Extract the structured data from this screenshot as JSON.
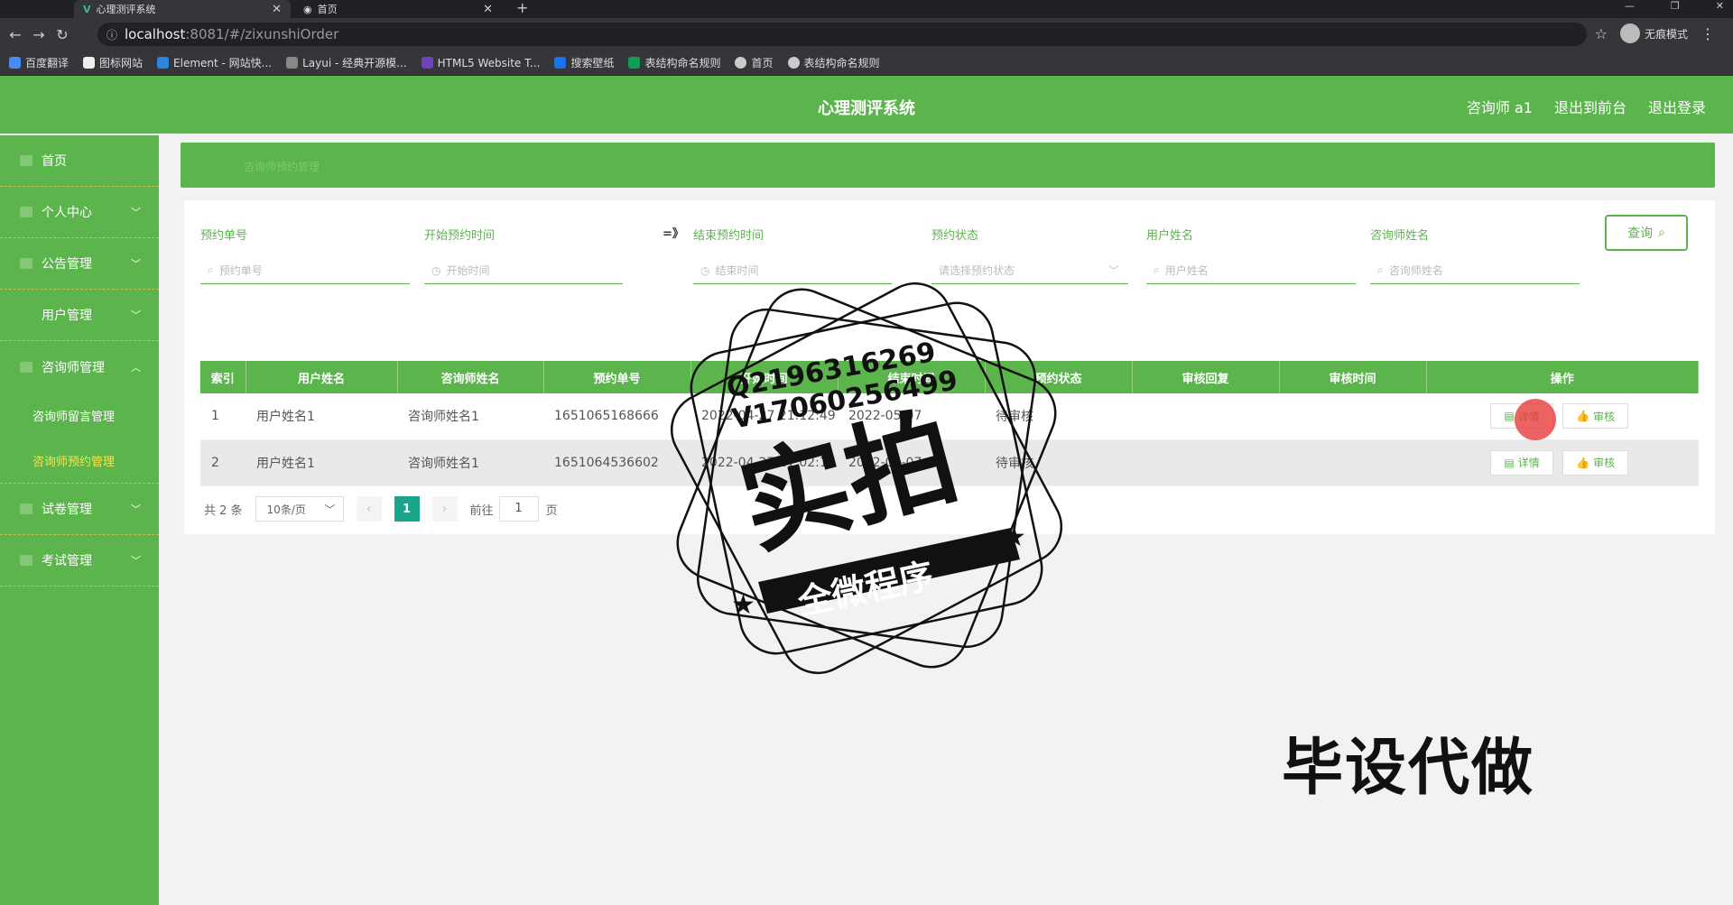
{
  "browser": {
    "tabs": [
      {
        "title": "心理测评系统",
        "close": "✕"
      },
      {
        "title": "首页",
        "close": "✕"
      }
    ],
    "new_tab": "+",
    "url_host": "localhost",
    "url_path": ":8081/#/zixunshiOrder",
    "incognito_label": "无痕模式",
    "bookmarks": [
      "百度翻译",
      "图标网站",
      "Element - 网站快...",
      "Layui - 经典开源模...",
      "HTML5 Website T...",
      "搜索壁纸",
      "表结构命名规则",
      "首页",
      "表结构命名规则"
    ]
  },
  "header": {
    "title": "心理测评系统",
    "links": [
      "咨询师 a1",
      "退出到前台",
      "退出登录"
    ]
  },
  "sidebar": {
    "items": [
      {
        "label": "首页",
        "chevron": ""
      },
      {
        "label": "个人中心",
        "chevron": "﹀"
      },
      {
        "label": "公告管理",
        "chevron": "﹀"
      },
      {
        "label": "用户管理",
        "chevron": "﹀"
      },
      {
        "label": "咨询师管理",
        "chevron": "︿"
      }
    ],
    "sub_items": [
      "咨询师留言管理",
      "咨询师预约管理"
    ],
    "items_after": [
      {
        "label": "试卷管理",
        "chevron": "﹀"
      },
      {
        "label": "考试管理",
        "chevron": "﹀"
      }
    ]
  },
  "breadcrumb": "咨询师预约管理",
  "filters": [
    {
      "label": "预约单号",
      "placeholder": "预约单号"
    },
    {
      "label": "开始预约时间",
      "placeholder": "开始时间"
    },
    {
      "label": "结束预约时间",
      "placeholder": "结束时间"
    },
    {
      "label": "预约状态",
      "placeholder": "请选择预约状态"
    },
    {
      "label": "用户姓名",
      "placeholder": "用户姓名"
    },
    {
      "label": "咨询师姓名",
      "placeholder": "咨询师姓名"
    }
  ],
  "range_arrow": "=》",
  "query_label": "查询",
  "table": {
    "headers": [
      "索引",
      "用户姓名",
      "咨询师姓名",
      "预约单号",
      "开始时间",
      "结束时间",
      "预约状态",
      "审核回复",
      "审核时间",
      "操作"
    ],
    "rows": [
      [
        "1",
        "用户姓名1",
        "咨询师姓名1",
        "1651065168666",
        "2022-04-27 21:12:49",
        "2022-05-07",
        "待审核",
        "",
        ""
      ],
      [
        "2",
        "用户姓名1",
        "咨询师姓名1",
        "1651064536602",
        "2022-04-27 21:02:17",
        "2022-05-07",
        "待审核",
        "",
        ""
      ]
    ],
    "detail_label": "详情",
    "audit_label": "审核"
  },
  "pager": {
    "total": "共 2 条",
    "page_size": "10条/页",
    "current": "1",
    "goto_prefix": "前往",
    "goto_value": "1",
    "goto_suffix": "页"
  },
  "overlay": {
    "qq": "Q2196316269",
    "vx": "V17060256499",
    "big": "实拍",
    "ribbon": "全微程序",
    "promo": "毕设代做"
  }
}
